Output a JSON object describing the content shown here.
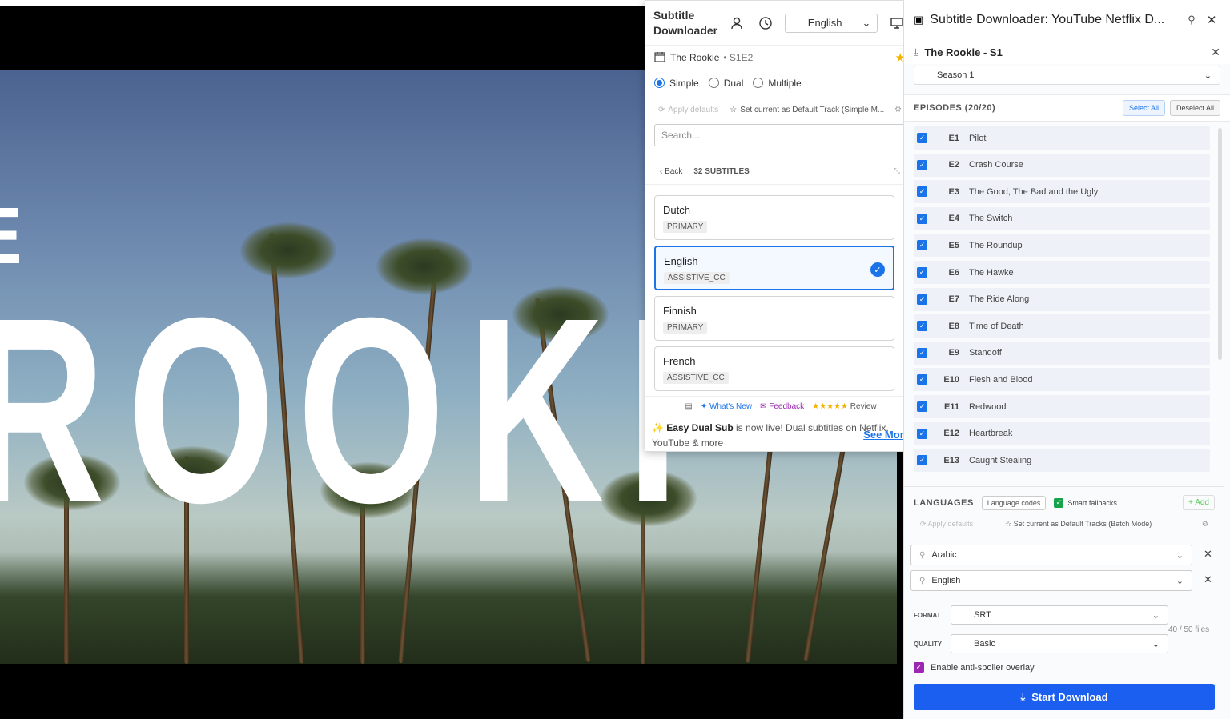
{
  "video": {
    "title_text": "ROOKI",
    "title_partial": "E"
  },
  "popup": {
    "title": "Subtitle Downloader",
    "language_select": "English",
    "show": {
      "name": "The Rookie",
      "episode": "• S1E2"
    },
    "modes": [
      "Simple",
      "Dual",
      "Multiple"
    ],
    "selected_mode": "Simple",
    "apply_defaults": "Apply defaults",
    "set_default": "Set current as Default Track (Simple M...",
    "search_placeholder": "Search...",
    "back_label": "Back",
    "count_label": "32 SUBTITLES",
    "subtitles": [
      {
        "name": "Dutch",
        "tag": "PRIMARY",
        "selected": false
      },
      {
        "name": "English",
        "tag": "ASSISTIVE_CC",
        "selected": true
      },
      {
        "name": "Finnish",
        "tag": "PRIMARY",
        "selected": false
      },
      {
        "name": "French",
        "tag": "ASSISTIVE_CC",
        "selected": false
      }
    ],
    "footer": {
      "whats_new": "What's New",
      "feedback": "Feedback",
      "stars": "★★★★★",
      "review": "Review"
    },
    "promo": {
      "bold": "Easy Dual Sub",
      "text": "is now live! Dual subtitles on Netflix, YouTube & more",
      "see_more": "See More"
    }
  },
  "panel": {
    "title": "Subtitle Downloader: YouTube Netflix D...",
    "show_title": "The Rookie - S1",
    "season": "Season 1",
    "episodes_label": "EPISODES (20/20)",
    "select_all": "Select All",
    "deselect_all": "Deselect All",
    "episodes": [
      {
        "code": "E1",
        "title": "Pilot"
      },
      {
        "code": "E2",
        "title": "Crash Course"
      },
      {
        "code": "E3",
        "title": "The Good, The Bad and the Ugly"
      },
      {
        "code": "E4",
        "title": "The Switch"
      },
      {
        "code": "E5",
        "title": "The Roundup"
      },
      {
        "code": "E6",
        "title": "The Hawke"
      },
      {
        "code": "E7",
        "title": "The Ride Along"
      },
      {
        "code": "E8",
        "title": "Time of Death"
      },
      {
        "code": "E9",
        "title": "Standoff"
      },
      {
        "code": "E10",
        "title": "Flesh and Blood"
      },
      {
        "code": "E11",
        "title": "Redwood"
      },
      {
        "code": "E12",
        "title": "Heartbreak"
      },
      {
        "code": "E13",
        "title": "Caught Stealing"
      }
    ],
    "languages_label": "LANGUAGES",
    "language_codes": "Language codes",
    "smart_fallbacks": "Smart fallbacks",
    "add": "Add",
    "apply_defaults": "Apply defaults",
    "set_default": "Set current as Default Tracks (Batch Mode)",
    "languages": [
      "Arabic",
      "English"
    ],
    "format_label": "FORMAT",
    "format": "SRT",
    "quality_label": "QUALITY",
    "quality": "Basic",
    "files": "40 / 50 files",
    "anti_spoiler": "Enable anti-spoiler overlay",
    "start": "Start Download"
  }
}
